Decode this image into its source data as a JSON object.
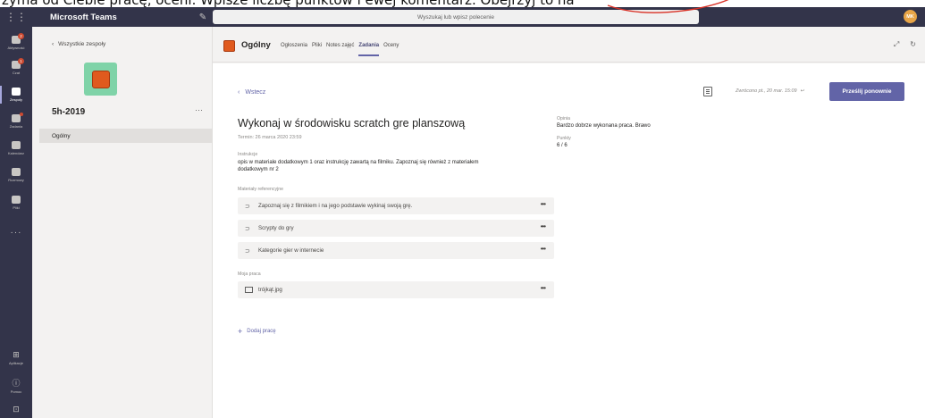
{
  "caption": {
    "text": "żyma od Ciebie pracę, oceni. Wpisze liczbę punktów  i ewej komentarz. Obejrzyj to na"
  },
  "topbar": {
    "app_name": "Microsoft Teams",
    "search_placeholder": "Wyszukaj lub wpisz polecenie",
    "avatar_initials": "MK"
  },
  "rail": {
    "items": [
      {
        "label": "Aktywność",
        "badge": "2"
      },
      {
        "label": "Czat",
        "badge": "1"
      },
      {
        "label": "Zespoły",
        "badge": ""
      },
      {
        "label": "Zadania",
        "badge": ""
      },
      {
        "label": "Kalendarz",
        "badge": ""
      },
      {
        "label": "Rozmowy",
        "badge": ""
      },
      {
        "label": "Pliki",
        "badge": ""
      }
    ],
    "more": "···",
    "bottom": [
      {
        "label": "Aplikacje"
      },
      {
        "label": "Pomoc"
      }
    ]
  },
  "teams_panel": {
    "back_label": "Wszystkie zespoły",
    "team_name": "5h-2019",
    "more": "···",
    "channel": "Ogólny"
  },
  "channel_header": {
    "name": "Ogólny",
    "tabs": [
      "Ogłoszenia",
      "Pliki",
      "Notes zajęć",
      "Zadania",
      "Oceny"
    ],
    "active_tab": 3
  },
  "assignment": {
    "back_label": "Wstecz",
    "turned_in": "Zwrócono pt., 20 mar. 15:09",
    "resubmit_label": "Prześlij ponownie",
    "title": "Wykonaj w środowisku scratch gre planszową",
    "due": "Termin: 26 marca 2020 23:59",
    "instructions_label": "Instrukcje",
    "instructions_line1": "opis w materiale dodatkowym 1 oraz instrukcję zawartą na filmiku. Zapoznaj się również z materiałem",
    "instructions_line2": "dodatkowym nr 2",
    "references_label": "Materiały referencyjne",
    "references": [
      "Zapoznaj się z filmikiem i na jego podstawie wykinaj swoją grę.",
      "Scrypty do gry",
      "Kategorie gier w internecie"
    ],
    "my_work_label": "Moja praca",
    "my_work_file": "trójkąt.jpg",
    "add_work_label": "Dodaj pracę",
    "feedback_label": "Opinia",
    "feedback_text": "Bardzo dobrze wykonana praca. Brawo",
    "points_label": "Punkty",
    "points_value": "6 / 6"
  },
  "colors": {
    "accent": "#6264a7",
    "rail_bg": "#33344a",
    "team_avatar_bg": "#7fd3a8",
    "team_avatar_fg": "#e05a1e"
  }
}
